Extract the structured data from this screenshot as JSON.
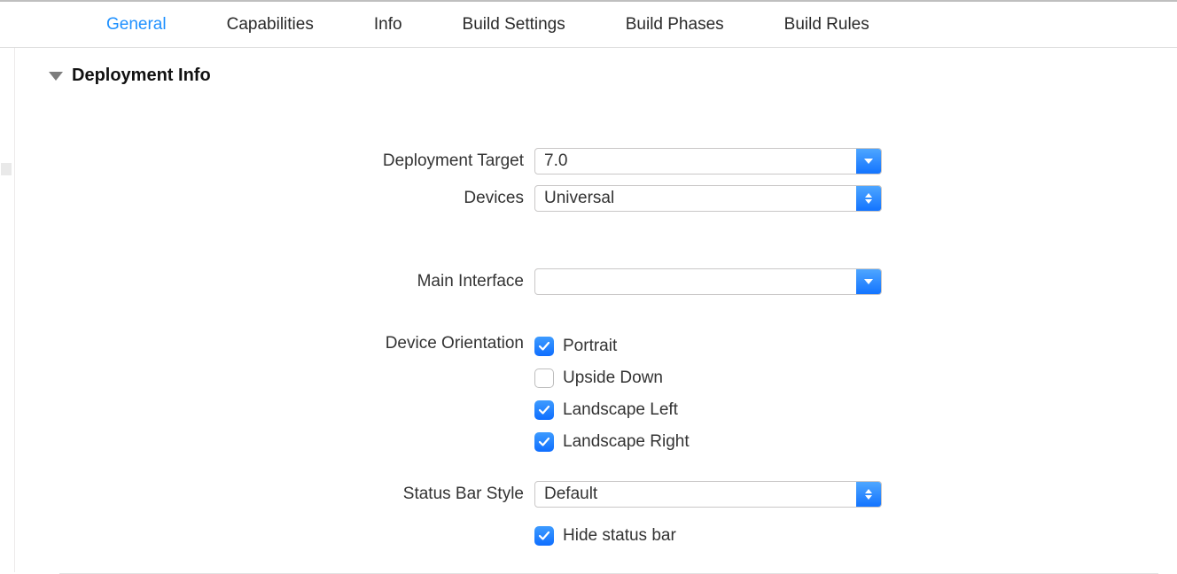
{
  "tabs": {
    "general": "General",
    "capabilities": "Capabilities",
    "info": "Info",
    "build_settings": "Build Settings",
    "build_phases": "Build Phases",
    "build_rules": "Build Rules"
  },
  "section": {
    "title": "Deployment Info"
  },
  "labels": {
    "deployment_target": "Deployment Target",
    "devices": "Devices",
    "main_interface": "Main Interface",
    "device_orientation": "Device Orientation",
    "status_bar_style": "Status Bar Style"
  },
  "values": {
    "deployment_target": "7.0",
    "devices": "Universal",
    "main_interface": "",
    "status_bar_style": "Default"
  },
  "orientations": {
    "portrait": {
      "label": "Portrait",
      "checked": true
    },
    "upside_down": {
      "label": "Upside Down",
      "checked": false
    },
    "landscape_left": {
      "label": "Landscape Left",
      "checked": true
    },
    "landscape_right": {
      "label": "Landscape Right",
      "checked": true
    }
  },
  "status_bar": {
    "hide_label": "Hide status bar",
    "hide_checked": true
  }
}
